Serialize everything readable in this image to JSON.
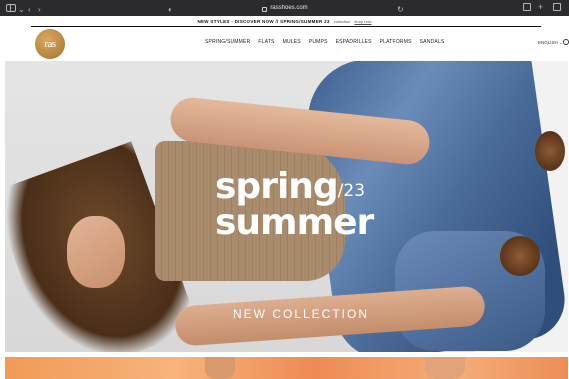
{
  "browser": {
    "address": "rasshoes.com",
    "icons": [
      "sidebar-icon",
      "chevron-down-icon",
      "back-icon",
      "forward-icon",
      "privacy-icon",
      "lock-icon",
      "reload-icon",
      "share-icon",
      "new-tab-icon",
      "tabs-icon"
    ]
  },
  "announcement": {
    "message": "NEW STYLES - DISCOVER NOW // SPRING/SUMMER 23",
    "sub": "collection",
    "link": "shop now"
  },
  "header": {
    "logo_text": "ras",
    "nav": [
      "SPRING/SUMMER",
      "FLATS",
      "MULES",
      "PUMPS",
      "ESPADRILLES",
      "PLATFORMS",
      "SANDALS"
    ],
    "language": "ENGLISH",
    "accent_color": "#b4823b"
  },
  "hero": {
    "title_line1": "spring",
    "title_year": "/23",
    "title_line2": "summer",
    "subtitle": "NEW COLLECTION"
  }
}
